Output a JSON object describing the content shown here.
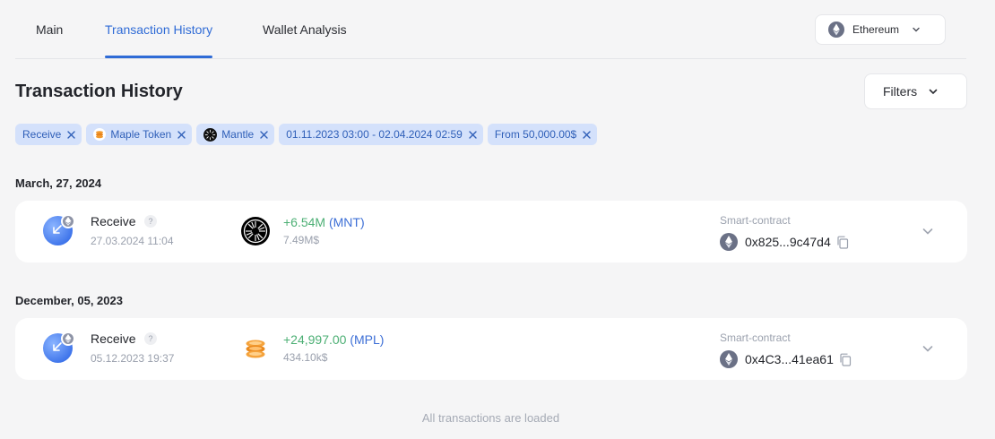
{
  "tabs": [
    {
      "label": "Main",
      "active": false
    },
    {
      "label": "Transaction History",
      "active": true
    },
    {
      "label": "Wallet Analysis",
      "active": false
    }
  ],
  "network": {
    "label": "Ethereum",
    "icon": "ethereum-icon"
  },
  "page_title": "Transaction History",
  "filters_button": {
    "label": "Filters"
  },
  "chips": [
    {
      "label": "Receive",
      "icon": null
    },
    {
      "label": "Maple Token",
      "icon": "maple-token-icon"
    },
    {
      "label": "Mantle",
      "icon": "mantle-icon"
    },
    {
      "label": "01.11.2023 03:00 - 02.04.2024 02:59",
      "icon": null
    },
    {
      "label": "From 50,000.00$",
      "icon": null
    }
  ],
  "groups": [
    {
      "date": "March, 27, 2024",
      "tx": {
        "type": "Receive",
        "help": "?",
        "time": "27.03.2024 11:04",
        "token_icon": "mantle-icon",
        "amount": "+6.54M",
        "symbol": "(MNT)",
        "usd": "7.49M$",
        "contract_label": "Smart-contract",
        "address": "0x825...9c47d4"
      }
    },
    {
      "date": "December, 05, 2023",
      "tx": {
        "type": "Receive",
        "help": "?",
        "time": "05.12.2023 19:37",
        "token_icon": "maple-token-icon",
        "amount": "+24,997.00",
        "symbol": "(MPL)",
        "usd": "434.10k$",
        "contract_label": "Smart-contract",
        "address": "0x4C3...41ea61"
      }
    }
  ],
  "footer": "All transactions are loaded",
  "colors": {
    "accent": "#2f6bd6",
    "chip_bg": "#d4e1fb",
    "positive": "#4caf74",
    "muted": "#9aa0ad",
    "background": "#f5f5f6"
  }
}
